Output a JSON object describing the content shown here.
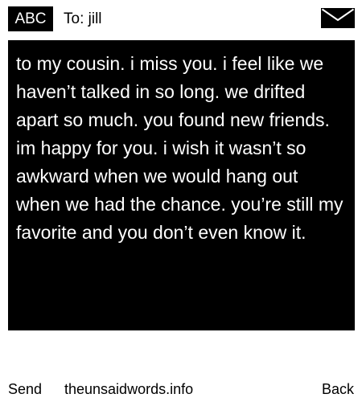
{
  "header": {
    "input_mode": "ABC",
    "to_line": "To: jill",
    "icon": "envelope-icon"
  },
  "message": {
    "text": "to my cousin. i miss you. i feel like we haven’t talked in so long. we drifted apart so much. you found new friends. im happy for you. i wish it wasn’t so awkward when we would hang out when we had the chance. you’re still my favorite and you don’t even know it."
  },
  "footer": {
    "send_label": "Send",
    "site_label": "theunsaidwords.info",
    "back_label": "Back"
  },
  "colors": {
    "background": "#ffffff",
    "message_background": "#000000",
    "message_text": "#ffffff"
  }
}
